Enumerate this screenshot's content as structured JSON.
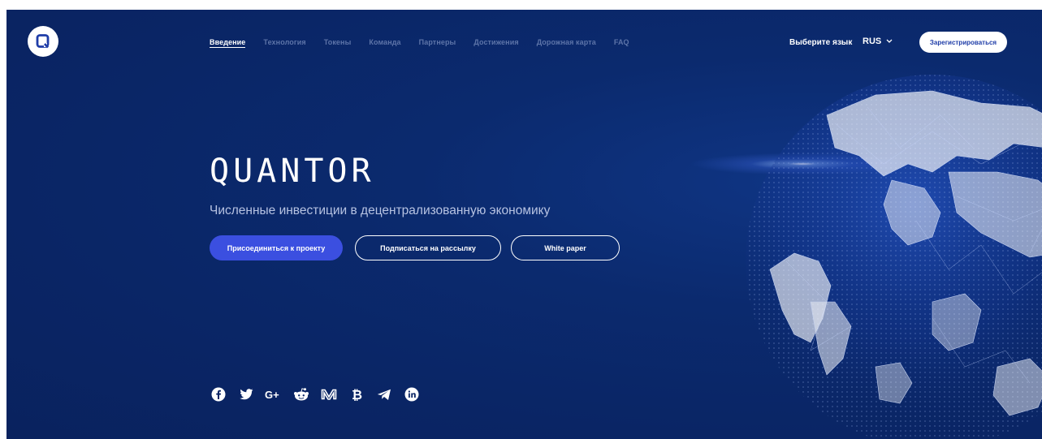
{
  "nav": {
    "items": [
      {
        "label": "Введение",
        "active": true
      },
      {
        "label": "Технология",
        "active": false
      },
      {
        "label": "Токены",
        "active": false
      },
      {
        "label": "Команда",
        "active": false
      },
      {
        "label": "Партнеры",
        "active": false
      },
      {
        "label": "Достижения",
        "active": false
      },
      {
        "label": "Дорожная карта",
        "active": false
      },
      {
        "label": "FAQ",
        "active": false
      }
    ],
    "language_label": "Выберите язык",
    "language_value": "RUS",
    "register_label": "Зарегистрироваться"
  },
  "hero": {
    "brand": "QUANTOR",
    "tagline": "Численные инвестиции в децентрализованную экономику",
    "buttons": {
      "join": "Присоединиться к проекту",
      "subscribe": "Подписаться на рассылку",
      "whitepaper": "White paper"
    }
  },
  "social": [
    "facebook-icon",
    "twitter-icon",
    "google-plus-icon",
    "reddit-icon",
    "medium-icon",
    "bitcointalk-icon",
    "telegram-icon",
    "linkedin-icon"
  ],
  "colors": {
    "background": "#0a2565",
    "accent": "#3b4fe0",
    "nav_inactive": "#5d74a8",
    "text": "#ffffff"
  }
}
